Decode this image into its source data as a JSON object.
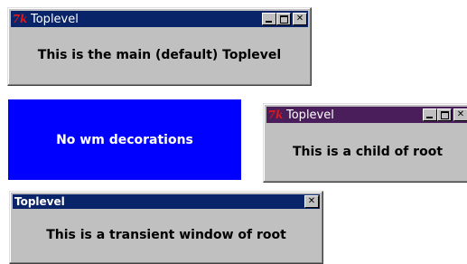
{
  "main_window": {
    "title": "Toplevel",
    "logo": "7k",
    "body": "This is the main (default) Toplevel",
    "titlebar_color": "#0a246a",
    "controls": [
      "minimize",
      "maximize",
      "close"
    ]
  },
  "no_decor_window": {
    "body": "No wm decorations",
    "background": "#0000ff"
  },
  "child_window": {
    "title": "Toplevel",
    "logo": "7k",
    "body": "This is a child of root",
    "titlebar_color": "#4a1e5a",
    "controls": [
      "minimize",
      "maximize",
      "close"
    ]
  },
  "transient_window": {
    "title": "Toplevel",
    "body": "This is a transient window of root",
    "titlebar_color": "#0a246a",
    "controls": [
      "close"
    ]
  }
}
